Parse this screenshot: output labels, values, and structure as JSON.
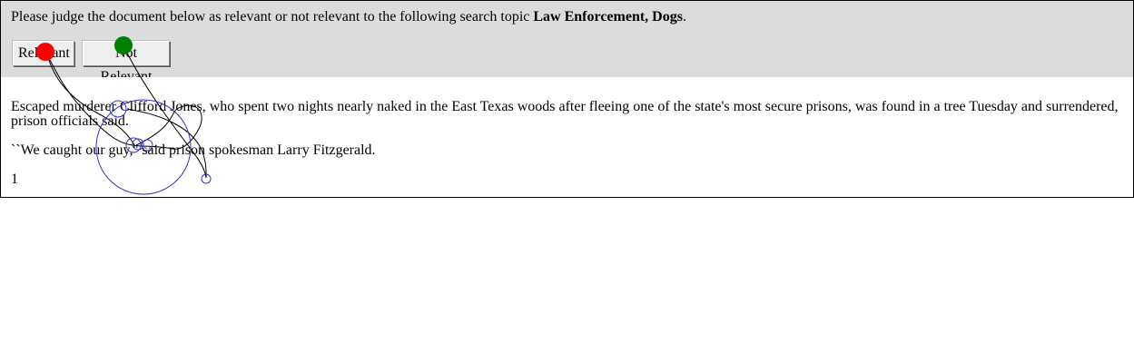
{
  "judge": {
    "prompt_prefix": "Please judge the document below as relevant or not relevant to the following search topic ",
    "topic": "Law Enforcement, Dogs",
    "prompt_suffix": ".",
    "relevant_label": "Relevant",
    "not_relevant_label": "Not Relevant"
  },
  "document": {
    "paragraphs": [
      "Escaped murderer Clifford Jones, who spent two nights nearly naked in the East Texas woods after fleeing one of the state's most secure prisons, was found in a tree Tuesday and surrendered, prison officials said.",
      "``We caught our guy,'' said prison spokesman Larry Fitzgerald."
    ],
    "page_number": "1"
  },
  "overlay": {
    "colors": {
      "start_marker": "#ff0000",
      "end_marker": "#008000",
      "fixation": "#3333cc",
      "path": "#000000"
    }
  }
}
